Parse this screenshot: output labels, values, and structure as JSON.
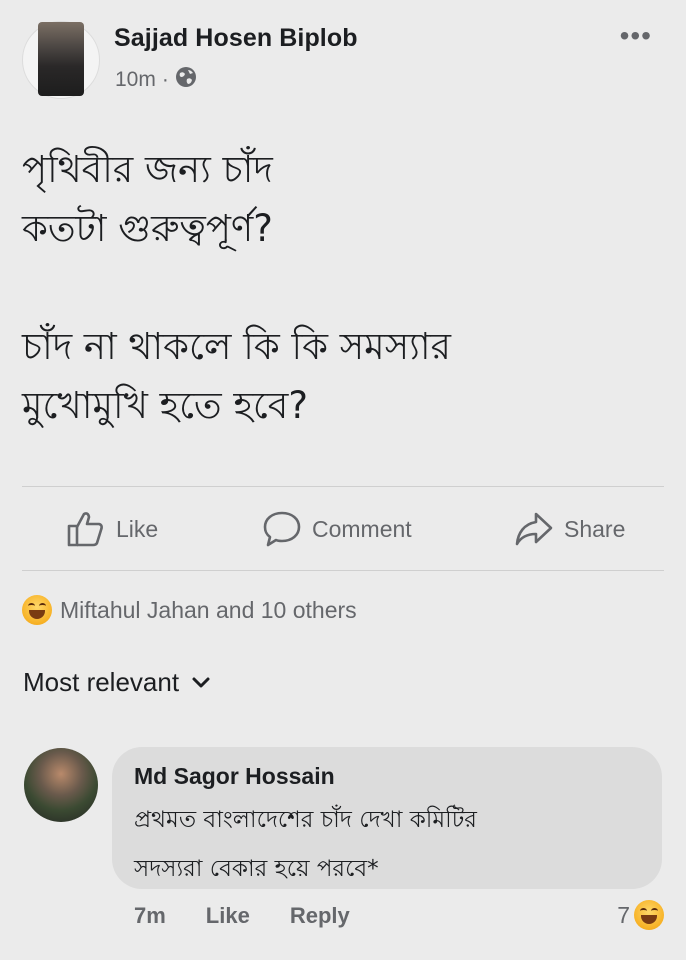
{
  "post": {
    "author": "Sajjad Hosen Biplob",
    "time": "10m",
    "separator": "·",
    "more": "•••",
    "lines": [
      "পৃথিবীর জন্য চাঁদ",
      "কতটা গুরুত্বপূর্ণ?",
      "চাঁদ না থাকলে কি কি সমস্যার",
      "মুখোমুখি হতে হবে?"
    ]
  },
  "actions": {
    "like": "Like",
    "comment": "Comment",
    "share": "Share"
  },
  "reactions": {
    "summary": "Miftahul Jahan and 10 others",
    "icon": "haha-emoji"
  },
  "sort": {
    "label": "Most relevant"
  },
  "comment": {
    "author": "Md Sagor Hossain",
    "line1": "প্রথমত বাংলাদেশের চাঁদ দেখা কমিটির",
    "line2": "সদস্যরা বেকার হয়ে পরবে*",
    "time": "7m",
    "like": "Like",
    "reply": "Reply",
    "reaction_count": "7"
  }
}
